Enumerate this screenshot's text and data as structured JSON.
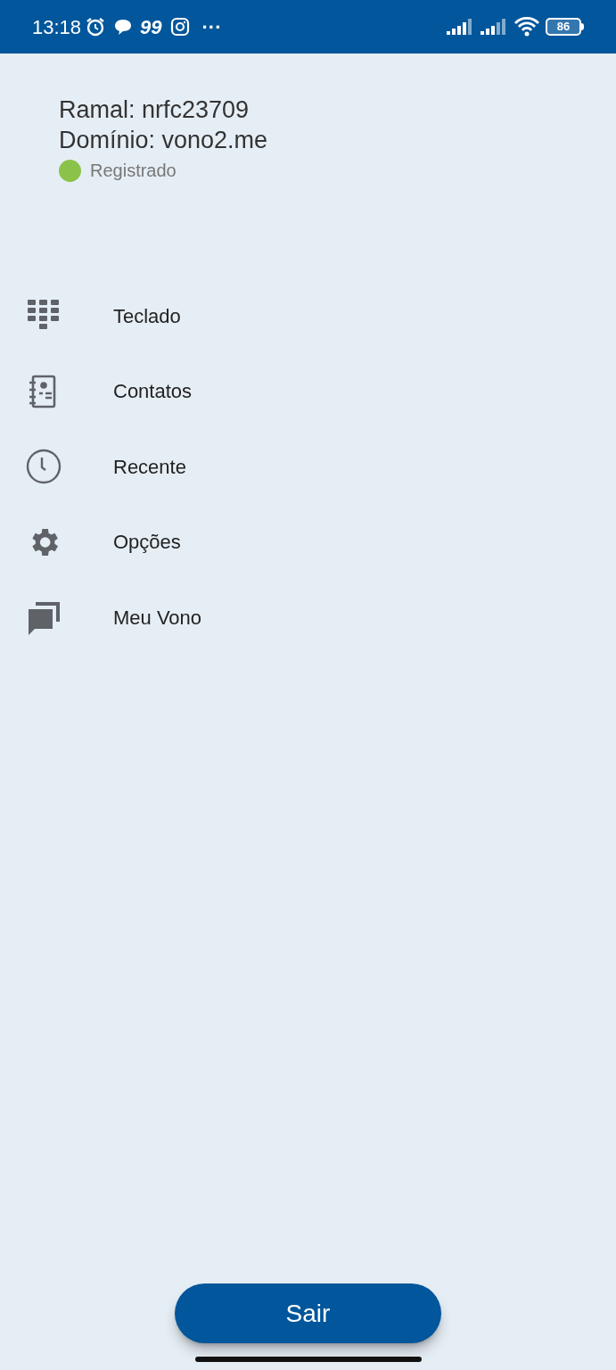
{
  "status_bar": {
    "time": "13:18",
    "notification_count": "99",
    "more": "···",
    "battery": "86"
  },
  "account": {
    "extension": "Ramal: nrfc23709",
    "domain": "Domínio: vono2.me",
    "status": {
      "label": "Registrado",
      "color": "#8bc34a"
    }
  },
  "menu": [
    {
      "kind": "keypad",
      "label": "Teclado"
    },
    {
      "kind": "contacts",
      "label": "Contatos"
    },
    {
      "kind": "recent",
      "label": "Recente"
    },
    {
      "kind": "settings",
      "label": "Opções"
    },
    {
      "kind": "chat",
      "label": "Meu Vono"
    }
  ],
  "logout_button": "Sair"
}
